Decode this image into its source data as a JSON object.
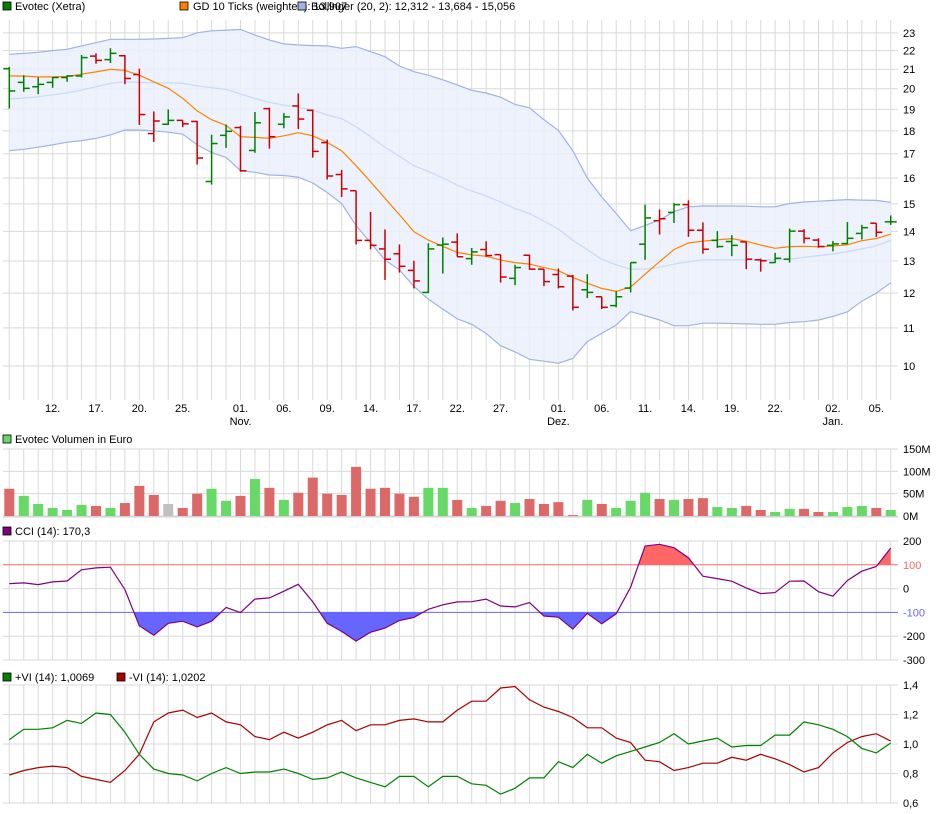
{
  "legend": {
    "price": "Evotec (Xetra)",
    "ma": "GD 10 Ticks (weighted): 13,907",
    "bollinger": "Bollinger (20, 2): 12,312 - 13,684 - 15,056",
    "volume": "Evotec Volumen in Euro",
    "cci": "CCI (14): 170,3",
    "vi_plus": "+VI (14): 1,0069",
    "vi_minus": "-VI (14): 1,0202"
  },
  "colors": {
    "up": "#008000",
    "down": "#cc0000",
    "ma": "#ff8000",
    "band_fill": "#eaf0fc",
    "band_line": "#9fb4e2",
    "band_mid": "#c8d9f8",
    "vol_up": "#66d966",
    "vol_down": "#dc6868",
    "vol_flat": "#c0c0c0",
    "cci": "#800080",
    "cci_hi": "#ff6666",
    "cci_lo": "#6666ff",
    "vi_plus": "#008000",
    "vi_minus": "#aa0000"
  },
  "chart_data": [
    {
      "type": "ohlc",
      "title": "Evotec (Xetra)",
      "yscale": "log",
      "ylim": [
        9.3,
        23.5
      ],
      "yticks": [
        10,
        11,
        12,
        13,
        14,
        15,
        16,
        17,
        18,
        19,
        20,
        21,
        22,
        23
      ],
      "x_ticks": [
        {
          "bar": 3,
          "day": "12."
        },
        {
          "bar": 6,
          "day": "17."
        },
        {
          "bar": 9,
          "day": "20."
        },
        {
          "bar": 12,
          "day": "25."
        },
        {
          "bar": 16,
          "day": "01.",
          "month": "Nov."
        },
        {
          "bar": 19,
          "day": "06."
        },
        {
          "bar": 22,
          "day": "09."
        },
        {
          "bar": 25,
          "day": "14."
        },
        {
          "bar": 28,
          "day": "17."
        },
        {
          "bar": 31,
          "day": "22."
        },
        {
          "bar": 34,
          "day": "27."
        },
        {
          "bar": 38,
          "day": "01.",
          "month": "Dez."
        },
        {
          "bar": 41,
          "day": "06."
        },
        {
          "bar": 44,
          "day": "11."
        },
        {
          "bar": 47,
          "day": "14."
        },
        {
          "bar": 50,
          "day": "19."
        },
        {
          "bar": 53,
          "day": "22."
        },
        {
          "bar": 57,
          "day": "02.",
          "month": "Jan."
        },
        {
          "bar": 60,
          "day": "05."
        }
      ],
      "ohlc": [
        [
          21.03,
          21.12,
          19.03,
          19.89
        ],
        [
          20.32,
          20.69,
          19.85,
          20.02
        ],
        [
          20.1,
          20.57,
          19.73,
          20.22
        ],
        [
          20.32,
          20.6,
          20.05,
          20.57
        ],
        [
          20.57,
          20.69,
          20.35,
          20.65
        ],
        [
          20.65,
          21.76,
          20.57,
          21.62
        ],
        [
          21.7,
          21.85,
          21.29,
          21.47
        ],
        [
          21.51,
          22.13,
          21.33,
          21.85
        ],
        [
          21.72,
          21.76,
          20.23,
          20.52
        ],
        [
          20.72,
          21.03,
          18.27,
          18.75
        ],
        [
          17.88,
          18.9,
          17.51,
          18.45
        ],
        [
          18.3,
          18.99,
          18.27,
          18.48
        ],
        [
          18.48,
          18.48,
          18.17,
          18.32
        ],
        [
          18.43,
          18.45,
          16.55,
          16.82
        ],
        [
          15.86,
          17.83,
          15.74,
          17.44
        ],
        [
          17.8,
          18.29,
          17.25,
          17.98
        ],
        [
          18.15,
          18.23,
          16.25,
          16.29
        ],
        [
          17.14,
          18.87,
          17.04,
          18.37
        ],
        [
          19.03,
          19.08,
          17.22,
          17.74
        ],
        [
          18.3,
          18.82,
          18.12,
          18.64
        ],
        [
          19.16,
          19.77,
          18.08,
          18.54
        ],
        [
          18.95,
          18.99,
          16.84,
          17.1
        ],
        [
          17.48,
          17.61,
          15.94,
          16.08
        ],
        [
          16.14,
          16.33,
          15.26,
          15.57
        ],
        [
          15.5,
          15.5,
          13.55,
          13.69
        ],
        [
          13.69,
          14.7,
          13.39,
          13.52
        ],
        [
          13.4,
          14.07,
          12.4,
          13.06
        ],
        [
          13.24,
          13.55,
          12.63,
          12.83
        ],
        [
          12.7,
          13.01,
          12.14,
          12.37
        ],
        [
          12.02,
          13.59,
          12.0,
          13.4
        ],
        [
          13.53,
          13.79,
          12.6,
          13.56
        ],
        [
          13.63,
          13.93,
          13.14,
          13.14
        ],
        [
          13.08,
          13.43,
          12.88,
          13.3
        ],
        [
          13.38,
          13.66,
          13.14,
          13.18
        ],
        [
          13.21,
          13.21,
          12.32,
          12.49
        ],
        [
          12.45,
          12.88,
          12.24,
          12.79
        ],
        [
          13.19,
          13.21,
          12.72,
          12.74
        ],
        [
          12.74,
          12.74,
          12.21,
          12.35
        ],
        [
          12.57,
          12.76,
          12.14,
          12.19
        ],
        [
          12.52,
          12.56,
          11.49,
          11.58
        ],
        [
          12.1,
          12.58,
          11.85,
          12.02
        ],
        [
          11.89,
          11.89,
          11.53,
          11.58
        ],
        [
          11.63,
          12.06,
          11.58,
          11.89
        ],
        [
          12.15,
          12.95,
          12.02,
          12.95
        ],
        [
          13.56,
          14.97,
          13.04,
          14.48
        ],
        [
          14.38,
          14.79,
          13.89,
          14.45
        ],
        [
          14.68,
          15.03,
          14.3,
          14.97
        ],
        [
          14.97,
          15.13,
          13.81,
          14.04
        ],
        [
          14.04,
          14.32,
          13.24,
          13.39
        ],
        [
          13.69,
          14.01,
          13.43,
          13.48
        ],
        [
          13.65,
          13.87,
          13.16,
          13.52
        ],
        [
          13.64,
          13.64,
          12.74,
          13.06
        ],
        [
          13.04,
          13.08,
          12.66,
          13.01
        ],
        [
          12.95,
          13.27,
          12.94,
          13.09
        ],
        [
          13.06,
          14.1,
          12.95,
          14.01
        ],
        [
          14.01,
          14.08,
          13.59,
          13.76
        ],
        [
          13.7,
          13.76,
          13.44,
          13.48
        ],
        [
          13.52,
          13.67,
          13.32,
          13.57
        ],
        [
          13.58,
          14.33,
          13.56,
          13.76
        ],
        [
          13.93,
          14.23,
          13.72,
          14.13
        ],
        [
          14.29,
          14.29,
          13.81,
          13.97
        ],
        [
          14.34,
          14.57,
          14.23,
          14.34
        ]
      ],
      "ma10": [
        20.65,
        20.64,
        20.6,
        20.6,
        20.62,
        20.74,
        20.86,
        20.99,
        20.94,
        20.69,
        20.35,
        20.02,
        19.53,
        18.92,
        18.51,
        18.25,
        17.74,
        17.71,
        17.67,
        17.78,
        17.92,
        17.78,
        17.49,
        17.13,
        16.5,
        15.85,
        15.21,
        14.6,
        13.99,
        13.7,
        13.49,
        13.28,
        13.2,
        13.16,
        13.03,
        12.95,
        12.9,
        12.79,
        12.69,
        12.48,
        12.3,
        12.14,
        12.05,
        12.18,
        12.58,
        12.98,
        13.38,
        13.6,
        13.66,
        13.71,
        13.75,
        13.66,
        13.53,
        13.42,
        13.48,
        13.49,
        13.47,
        13.5,
        13.54,
        13.68,
        13.75,
        13.907
      ],
      "bollinger_upper": [
        21.8,
        21.85,
        21.91,
        22.0,
        22.07,
        22.26,
        22.44,
        22.63,
        22.63,
        22.63,
        22.65,
        22.68,
        22.72,
        23.0,
        23.12,
        23.16,
        23.19,
        22.87,
        22.59,
        22.37,
        22.31,
        22.28,
        22.26,
        22.13,
        22.22,
        21.94,
        21.67,
        21.17,
        20.87,
        20.69,
        20.45,
        20.19,
        19.92,
        19.79,
        19.58,
        19.23,
        19.07,
        18.51,
        18.02,
        17.13,
        16.0,
        15.26,
        14.64,
        14.02,
        14.21,
        14.41,
        14.71,
        14.89,
        14.92,
        14.92,
        14.92,
        14.91,
        14.89,
        14.89,
        15.01,
        15.07,
        15.1,
        15.13,
        15.16,
        15.14,
        15.13,
        15.056
      ],
      "bollinger_middle": [
        19.49,
        19.54,
        19.6,
        19.7,
        19.8,
        19.93,
        20.1,
        20.27,
        20.35,
        20.32,
        20.3,
        20.3,
        20.27,
        20.15,
        20.05,
        19.97,
        19.74,
        19.52,
        19.33,
        19.2,
        19.09,
        18.97,
        18.73,
        18.56,
        18.19,
        17.74,
        17.28,
        16.89,
        16.5,
        16.27,
        16.0,
        15.72,
        15.49,
        15.3,
        15.07,
        14.82,
        14.64,
        14.37,
        14.08,
        13.7,
        13.37,
        13.06,
        12.88,
        12.74,
        12.74,
        12.8,
        12.9,
        12.98,
        13.04,
        13.04,
        13.04,
        13.04,
        13.04,
        13.04,
        13.06,
        13.12,
        13.18,
        13.23,
        13.31,
        13.4,
        13.51,
        13.684
      ],
      "bollinger_lower": [
        17.13,
        17.19,
        17.28,
        17.38,
        17.5,
        17.57,
        17.67,
        17.82,
        18.04,
        18.04,
        18.0,
        17.94,
        17.85,
        17.38,
        17.05,
        16.84,
        16.3,
        16.23,
        16.12,
        16.1,
        16.03,
        15.8,
        15.43,
        15.01,
        14.2,
        13.61,
        13.03,
        12.72,
        12.2,
        11.82,
        11.53,
        11.25,
        11.1,
        10.85,
        10.52,
        10.36,
        10.17,
        10.12,
        10.07,
        10.19,
        10.63,
        10.85,
        11.08,
        11.46,
        11.34,
        11.22,
        11.06,
        11.06,
        11.13,
        11.13,
        11.12,
        11.11,
        11.1,
        11.1,
        11.15,
        11.17,
        11.22,
        11.32,
        11.45,
        11.76,
        12.0,
        12.312
      ]
    },
    {
      "type": "bar",
      "title": "Evotec Volumen in Euro",
      "unit": "M",
      "ylim": [
        0,
        150
      ],
      "yticks": [
        {
          "v": 0,
          "label": "0M"
        },
        {
          "v": 50,
          "label": "50M"
        },
        {
          "v": 100,
          "label": "100M"
        },
        {
          "v": 150,
          "label": "150M"
        }
      ],
      "values": [
        61,
        45,
        27,
        18,
        13.5,
        25,
        22.5,
        18,
        29,
        67.5,
        47,
        27,
        18,
        50,
        61,
        34,
        45,
        83,
        63,
        36,
        52,
        86,
        50,
        47,
        110,
        61,
        63,
        50,
        43,
        63,
        63,
        36,
        18,
        22.5,
        34,
        29,
        38,
        27,
        31,
        2,
        36,
        27,
        18,
        34,
        52,
        38,
        36,
        38,
        40,
        20,
        18,
        22.5,
        13.5,
        9,
        16,
        16,
        9,
        9,
        20,
        22.5,
        18,
        13.5
      ],
      "direction": [
        "d",
        "u",
        "u",
        "u",
        "u",
        "u",
        "d",
        "u",
        "d",
        "d",
        "d",
        "n",
        "d",
        "d",
        "u",
        "u",
        "d",
        "u",
        "d",
        "u",
        "d",
        "d",
        "d",
        "d",
        "d",
        "d",
        "d",
        "d",
        "d",
        "u",
        "u",
        "d",
        "u",
        "d",
        "d",
        "u",
        "d",
        "d",
        "d",
        "d",
        "u",
        "d",
        "u",
        "u",
        "u",
        "d",
        "u",
        "d",
        "d",
        "u",
        "u",
        "d",
        "d",
        "u",
        "u",
        "d",
        "d",
        "u",
        "u",
        "u",
        "d",
        "u"
      ]
    },
    {
      "type": "line",
      "title": "CCI (14): 170,3",
      "ylim": [
        -300,
        200
      ],
      "yticks": [
        200,
        100,
        0,
        -100,
        -200,
        -300
      ],
      "levels": [
        100,
        -100
      ],
      "values": [
        21,
        24,
        17,
        28,
        32,
        79,
        87,
        90,
        -4,
        -156,
        -196,
        -146,
        -137,
        -161,
        -137,
        -79,
        -101,
        -44,
        -39,
        -11,
        18,
        -56,
        -146,
        -180,
        -220,
        -183,
        -166,
        -134,
        -121,
        -87,
        -68,
        -56,
        -55,
        -44,
        -73,
        -77,
        -59,
        -115,
        -120,
        -170,
        -104,
        -148,
        -106,
        6,
        179,
        186,
        172,
        130,
        52,
        42,
        31,
        3,
        -21,
        -17,
        31,
        32,
        -13,
        -32,
        34,
        73,
        93,
        170.3
      ]
    },
    {
      "type": "line",
      "title": "Vortex Indicator (14)",
      "ylim": [
        0.6,
        1.4
      ],
      "yticks": [
        {
          "v": 1.4,
          "label": "1,4"
        },
        {
          "v": 1.2,
          "label": "1,2"
        },
        {
          "v": 1.0,
          "label": "1,0"
        },
        {
          "v": 0.8,
          "label": "0,8"
        },
        {
          "v": 0.6,
          "label": "0,6"
        }
      ],
      "series": [
        {
          "name": "+VI (14)",
          "values": [
            1.03,
            1.1,
            1.1,
            1.11,
            1.16,
            1.14,
            1.21,
            1.2,
            1.08,
            0.93,
            0.83,
            0.8,
            0.79,
            0.75,
            0.8,
            0.84,
            0.8,
            0.81,
            0.81,
            0.83,
            0.8,
            0.76,
            0.77,
            0.81,
            0.77,
            0.74,
            0.71,
            0.78,
            0.78,
            0.71,
            0.78,
            0.78,
            0.73,
            0.72,
            0.66,
            0.7,
            0.77,
            0.77,
            0.88,
            0.84,
            0.93,
            0.87,
            0.92,
            0.95,
            0.98,
            1.01,
            1.07,
            1.0,
            1.02,
            1.04,
            0.98,
            0.99,
            0.99,
            1.06,
            1.06,
            1.15,
            1.13,
            1.1,
            1.05,
            0.97,
            0.94,
            1.0069
          ]
        },
        {
          "name": "-VI (14)",
          "values": [
            0.79,
            0.82,
            0.84,
            0.85,
            0.84,
            0.78,
            0.76,
            0.74,
            0.82,
            0.93,
            1.15,
            1.21,
            1.23,
            1.18,
            1.21,
            1.15,
            1.13,
            1.05,
            1.03,
            1.08,
            1.04,
            1.08,
            1.13,
            1.16,
            1.09,
            1.13,
            1.13,
            1.16,
            1.17,
            1.15,
            1.15,
            1.23,
            1.29,
            1.29,
            1.38,
            1.39,
            1.3,
            1.25,
            1.22,
            1.18,
            1.11,
            1.11,
            1.04,
            1.01,
            0.89,
            0.88,
            0.82,
            0.84,
            0.87,
            0.87,
            0.91,
            0.89,
            0.93,
            0.9,
            0.86,
            0.81,
            0.84,
            0.94,
            1.01,
            1.05,
            1.07,
            1.0202
          ]
        }
      ]
    }
  ]
}
